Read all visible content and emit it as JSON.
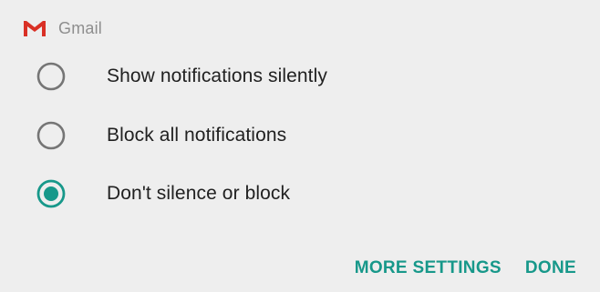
{
  "header": {
    "app_name": "Gmail",
    "icon": "gmail-icon"
  },
  "options": [
    {
      "label": "Show notifications silently",
      "selected": false
    },
    {
      "label": "Block all notifications",
      "selected": false
    },
    {
      "label": "Don't silence or block",
      "selected": true
    }
  ],
  "actions": {
    "more_settings_label": "MORE SETTINGS",
    "done_label": "DONE"
  },
  "colors": {
    "accent": "#17988a",
    "radio_unselected": "#757575",
    "gmail_red": "#d93025",
    "background": "#eeeeee"
  }
}
